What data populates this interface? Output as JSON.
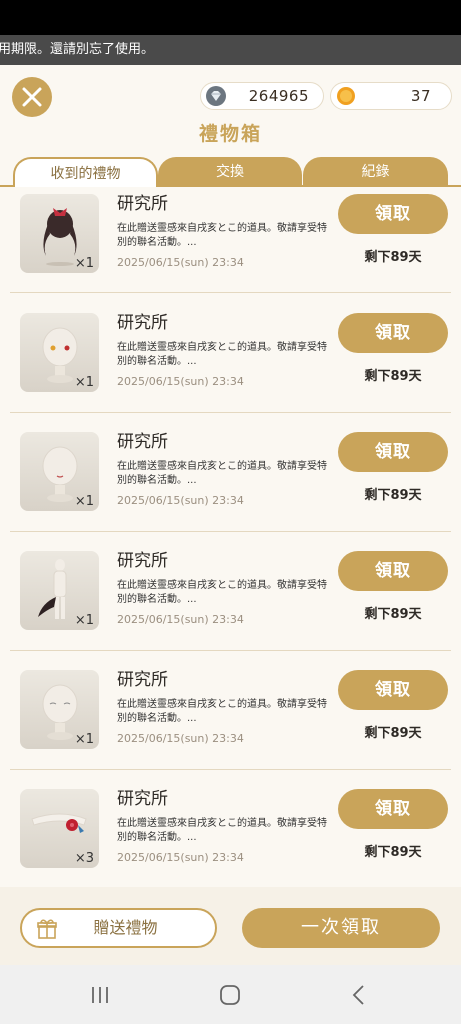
{
  "ticker": {
    "text": "用期限。還請別忘了使用。"
  },
  "currency": {
    "gems": "264965",
    "gold": "37"
  },
  "header": {
    "title": "禮物箱"
  },
  "tabs": [
    {
      "label": "收到的禮物"
    },
    {
      "label": "交換"
    },
    {
      "label": "紀錄"
    }
  ],
  "items": [
    {
      "name": "研究所",
      "desc": "在此贈送靈感來自戌亥とこ的道具。敬請享受特別的聯名活動。...",
      "date": "2025/06/15(sun) 23:34",
      "qty": "×1",
      "claim": "領取",
      "remain": "剩下89天",
      "icon": "hair-twin-tails-icon"
    },
    {
      "name": "研究所",
      "desc": "在此贈送靈感來自戌亥とこ的道具。敬請享受特別的聯名活動。...",
      "date": "2025/06/15(sun) 23:34",
      "qty": "×1",
      "claim": "領取",
      "remain": "剩下89天",
      "icon": "eyes-face-icon"
    },
    {
      "name": "研究所",
      "desc": "在此贈送靈感來自戌亥とこ的道具。敬請享受特別的聯名活動。...",
      "date": "2025/06/15(sun) 23:34",
      "qty": "×1",
      "claim": "領取",
      "remain": "剩下89天",
      "icon": "mouth-face-icon"
    },
    {
      "name": "研究所",
      "desc": "在此贈送靈感來自戌亥とこ的道具。敬請享受特別的聯名活動。...",
      "date": "2025/06/15(sun) 23:34",
      "qty": "×1",
      "claim": "領取",
      "remain": "剩下89天",
      "icon": "tail-icon"
    },
    {
      "name": "研究所",
      "desc": "在此贈送靈感來自戌亥とこ的道具。敬請享受特別的聯名活動。...",
      "date": "2025/06/15(sun) 23:34",
      "qty": "×1",
      "claim": "領取",
      "remain": "剩下89天",
      "icon": "closed-eyes-face-icon"
    },
    {
      "name": "研究所",
      "desc": "在此贈送靈感來自戌亥とこ的道具。敬請享受特別的聯名活動。...",
      "date": "2025/06/15(sun) 23:34",
      "qty": "×3",
      "claim": "領取",
      "remain": "剩下89天",
      "icon": "flower-headband-icon"
    }
  ],
  "footer": {
    "send_label": "贈送禮物",
    "bulk_label": "一次領取"
  },
  "colors": {
    "accent": "#c9a45a",
    "background": "#fbf8f2"
  }
}
